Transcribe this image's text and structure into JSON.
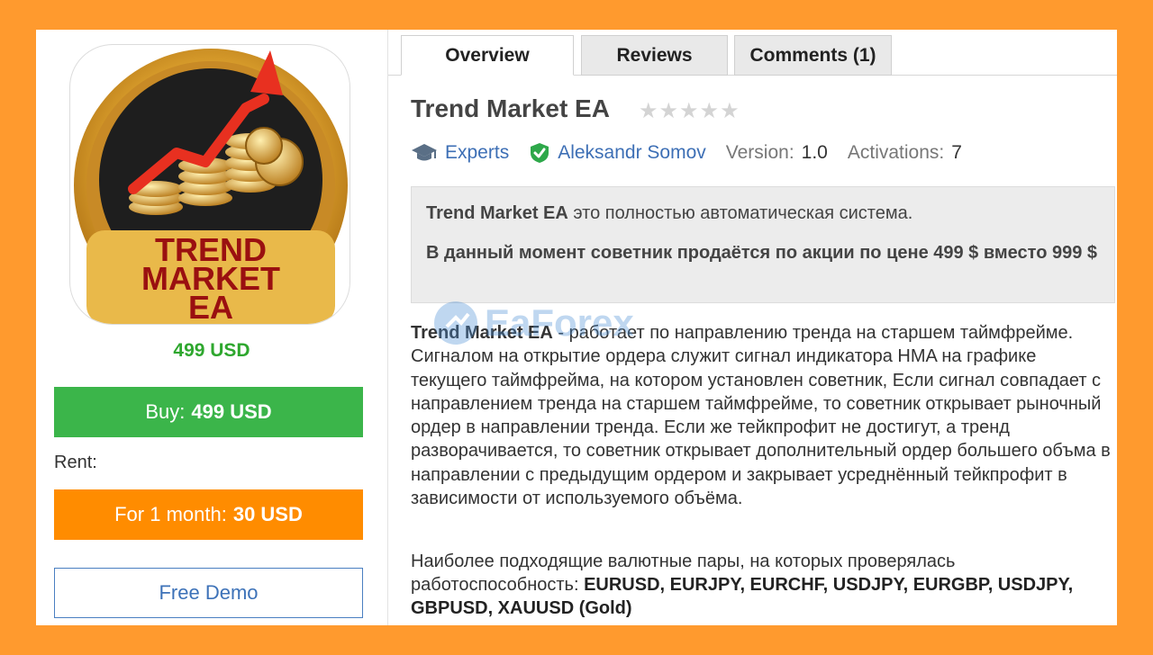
{
  "product": {
    "logo_lines": [
      "TREND",
      "MARKET",
      "EA"
    ],
    "price": "499 USD",
    "buy_prefix": "Buy:",
    "buy_value": "499 USD",
    "rent_label": "Rent:",
    "rent_prefix": "For 1 month:",
    "rent_value": "30 USD",
    "demo_label": "Free Demo"
  },
  "tabs": [
    {
      "label": "Overview",
      "active": true
    },
    {
      "label": "Reviews",
      "active": false
    },
    {
      "label": "Comments (1)",
      "active": false
    }
  ],
  "header": {
    "title": "Trend Market EA",
    "stars": "★★★★★",
    "category": "Experts",
    "author": "Aleksandr Somov",
    "version_label": "Version:",
    "version_value": "1.0",
    "activations_label": "Activations:",
    "activations_value": "7"
  },
  "notice": {
    "line1_name": "Trend Market EA",
    "line1_text": " это полностью автоматическая система.",
    "line2": "В данный момент советник продаётся по акции по цене 499 $ вместо 999 $"
  },
  "description": {
    "name": "Trend Market EA",
    "text": " - работает по направлению тренда на старшем таймфрейме. Сигналом на открытие ордера служит сигнал индикатора HMA на графике текущего таймфрейма, на котором установлен советник, Если сигнал совпадает с направлением тренда на старшем таймфрейме, то советник открывает рыночный ордер в направлении тренда. Если же тейкпрофит не достигут, а тренд разворачивается, то советник открывает дополнительный ордер большего объма в направлении с предыдущим ордером и закрывает усреднённый тейкпрофит в зависимости от используемого объёма."
  },
  "pairs": {
    "intro": "Наиболее подходящие валютные пары, на которых проверялась работоспособность: ",
    "list": "EURUSD, EURJPY, EURCHF, USDJPY, EURGBP, USDJPY, GBPUSD, XAUUSD (Gold)"
  },
  "watermark": "EaForex",
  "colors": {
    "background": "#ff9a2e",
    "buy": "#3bb54a",
    "rent": "#ff8c00",
    "link": "#3d6fb5",
    "price": "#2ea72e"
  }
}
